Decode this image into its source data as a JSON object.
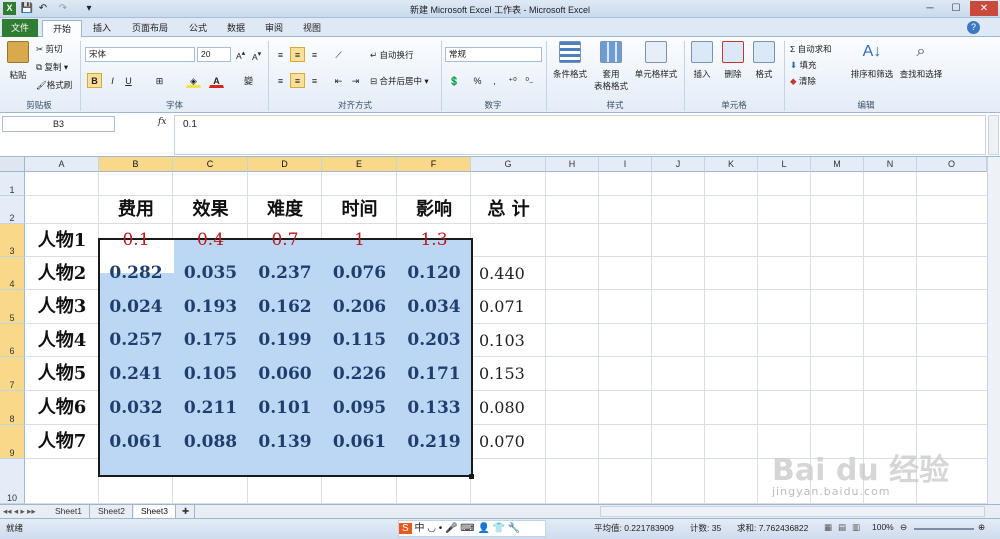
{
  "app": {
    "title": "新建 Microsoft Excel 工作表 - Microsoft Excel"
  },
  "tabs": [
    "文件",
    "开始",
    "插入",
    "页面布局",
    "公式",
    "数据",
    "审阅",
    "视图"
  ],
  "ribbon": {
    "clipboard": {
      "paste": "粘贴",
      "cut": "剪切",
      "copy": "复制",
      "format_painter": "格式刷",
      "label": "剪贴板"
    },
    "font": {
      "name": "宋体",
      "size": "20",
      "bold": "B",
      "italic": "I",
      "underline": "U",
      "label": "字体"
    },
    "alignment": {
      "wrap": "自动换行",
      "merge": "合并后居中",
      "label": "对齐方式"
    },
    "number": {
      "format": "常规",
      "label": "数字",
      "percent": "%"
    },
    "styles": {
      "conditional": "条件格式",
      "table_top": "套用",
      "table_bottom": "表格格式",
      "cell_styles": "单元格样式",
      "label": "样式"
    },
    "cells": {
      "insert": "插入",
      "delete": "删除",
      "format": "格式",
      "label": "单元格"
    },
    "editing": {
      "autosum": "Σ 自动求和",
      "fill": "填充",
      "clear": "清除",
      "sort": "排序和筛选",
      "find": "查找和选择",
      "label": "编辑"
    }
  },
  "formula_bar": {
    "name_box": "B3",
    "fx": "fx",
    "value": "0.1"
  },
  "columns": [
    "A",
    "B",
    "C",
    "D",
    "E",
    "F",
    "G",
    "H",
    "I",
    "J",
    "K",
    "L",
    "M",
    "N",
    "O"
  ],
  "rows": [
    "1",
    "2",
    "3",
    "4",
    "5",
    "6",
    "7",
    "8",
    "9",
    "10"
  ],
  "sheet": {
    "headers": [
      "费用",
      "效果",
      "难度",
      "时间",
      "影响"
    ],
    "total_header": "总 计",
    "weights_label": "人物1",
    "weights": [
      "0.1",
      "0.4",
      "0.7",
      "1",
      "1.3"
    ],
    "data": [
      {
        "label": "人物2",
        "values": [
          "0.282",
          "0.035",
          "0.237",
          "0.076",
          "0.120"
        ],
        "total": "0.440"
      },
      {
        "label": "人物3",
        "values": [
          "0.024",
          "0.193",
          "0.162",
          "0.206",
          "0.034"
        ],
        "total": "0.071"
      },
      {
        "label": "人物4",
        "values": [
          "0.257",
          "0.175",
          "0.199",
          "0.115",
          "0.203"
        ],
        "total": "0.103"
      },
      {
        "label": "人物5",
        "values": [
          "0.241",
          "0.105",
          "0.060",
          "0.226",
          "0.171"
        ],
        "total": "0.153"
      },
      {
        "label": "人物6",
        "values": [
          "0.032",
          "0.211",
          "0.101",
          "0.095",
          "0.133"
        ],
        "total": "0.080"
      },
      {
        "label": "人物7",
        "values": [
          "0.061",
          "0.088",
          "0.139",
          "0.061",
          "0.219"
        ],
        "total": "0.070"
      }
    ]
  },
  "sheet_tabs": [
    "Sheet1",
    "Sheet2",
    "Sheet3"
  ],
  "status": {
    "ready": "就绪",
    "average": "平均值: 0.221783909",
    "count": "计数: 35",
    "sum": "求和: 7.762436822",
    "zoom": "100%"
  },
  "watermark": "Bai du 经验",
  "watermark_url": "jingyan.baidu.com",
  "colors": {
    "selection": "#bcd7f3",
    "accent": "#2f7d33",
    "weights_red": "#c0161a"
  }
}
